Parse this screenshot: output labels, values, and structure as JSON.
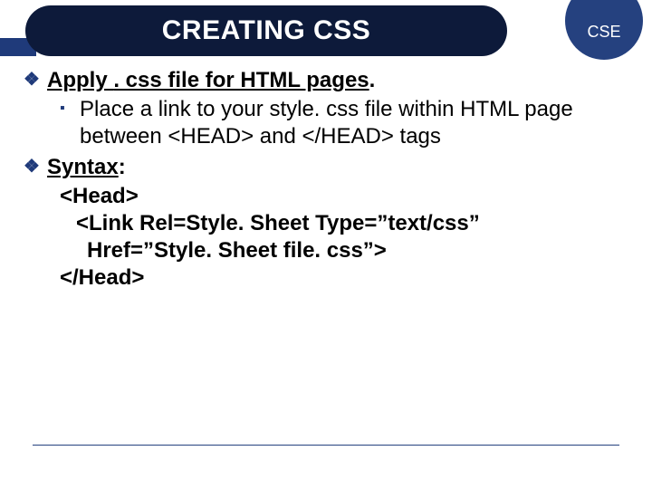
{
  "header": {
    "title": "CREATING CSS",
    "badge": "CSE"
  },
  "bullets": {
    "apply": {
      "lead": "Apply ",
      "rest": ". css file for HTML pages",
      "tail": ".",
      "sub": "Place a link to your style. css file within HTML page between <HEAD> and </HEAD> tags"
    },
    "syntax": {
      "label": "Syntax",
      "colon": ":",
      "line1": "<Head>",
      "line2": "<Link Rel=Style. Sheet Type=”text/css”",
      "line3": "Href=”Style. Sheet file. css”>",
      "line4": "</Head>"
    }
  },
  "icons": {
    "diamond": "❖",
    "square": "▪"
  }
}
